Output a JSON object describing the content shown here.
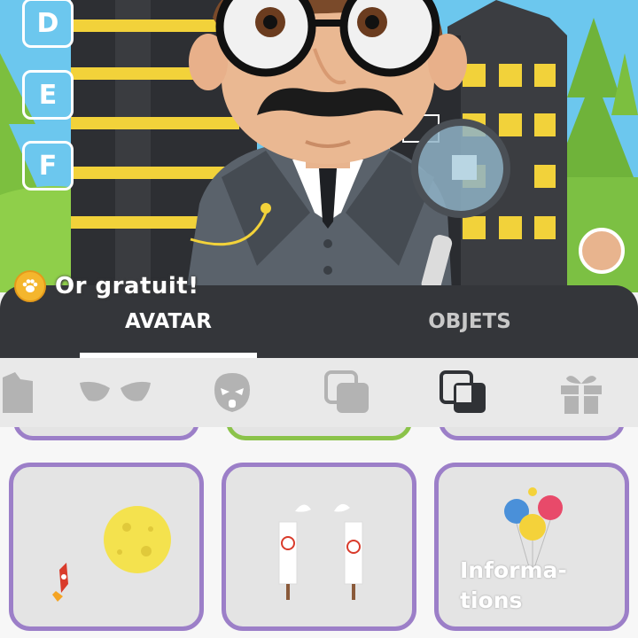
{
  "avatar_scene": {
    "letter_buttons": [
      "D",
      "E",
      "F"
    ],
    "free_gold_label": "Or gratuit!",
    "skin_color": "#e8b48e"
  },
  "tabs": [
    {
      "label": "AVATAR",
      "active": true
    },
    {
      "label": "OBJETS",
      "active": false
    }
  ],
  "category_icons": [
    "shirt-icon",
    "eyes-icon",
    "mask-icon",
    "layers-icon",
    "layers-selected-icon",
    "gift-icon"
  ],
  "items": [
    {
      "icon": "moon-rocket-icon"
    },
    {
      "icon": "protest-signs-icon"
    },
    {
      "icon": "balloons-icon",
      "label_line1": "Informa-",
      "label_line2": "tions"
    }
  ],
  "colors": {
    "tab_bar": "#34363a",
    "card_border_purple": "#9c7fc8",
    "card_border_green": "#8bc34a",
    "coin": "#f4b62d"
  }
}
